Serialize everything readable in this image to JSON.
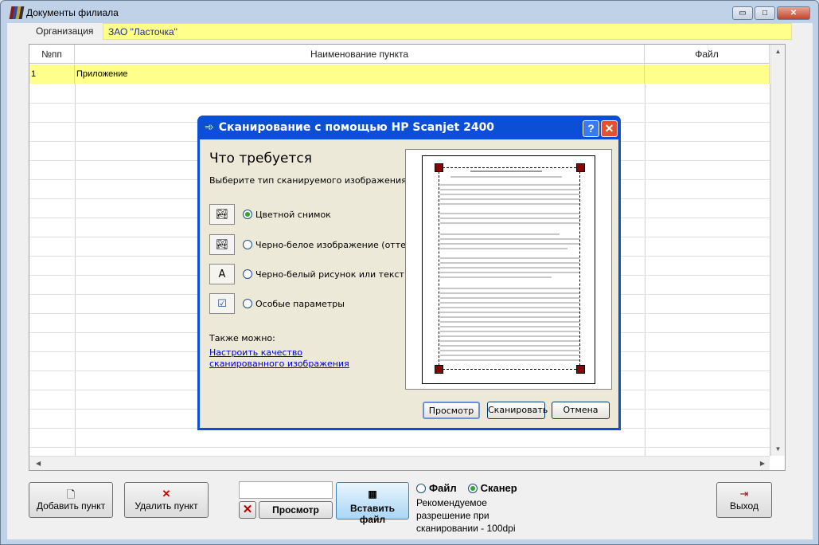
{
  "window": {
    "title": "Документы филиала",
    "min": "▭",
    "max": "□",
    "close": "✕"
  },
  "org": {
    "label": "Организация",
    "value": "ЗАО \"Ласточка\""
  },
  "grid": {
    "columns": [
      "№пп",
      "Наименование пункта",
      "Файл"
    ],
    "rows": [
      {
        "num": "1",
        "name": "Приложение",
        "file": ""
      }
    ]
  },
  "dialog": {
    "title": "Сканирование с помощью HP Scanjet 2400",
    "help": "?",
    "close": "✕",
    "heading": "Что требуется",
    "subtitle": "Выберите тип сканируемого изображения.",
    "options": [
      {
        "label": "Цветной снимок",
        "selected": true
      },
      {
        "label": "Черно-белое изображение (оттенки",
        "selected": false
      },
      {
        "label": "Черно-белый рисунок или текст",
        "selected": false
      },
      {
        "label": "Особые параметры",
        "selected": false
      }
    ],
    "also": "Также можно:",
    "link": "Настроить качество сканированного изображения",
    "buttons": {
      "preview": "Просмотр",
      "scan": "Сканировать",
      "cancel": "Отмена"
    }
  },
  "bottom": {
    "add": "Добавить пункт",
    "delete": "Удалить пункт",
    "file_input": "",
    "preview": "Просмотр",
    "insert": "Вставить файл",
    "source_file": "Файл",
    "source_scanner": "Сканер",
    "source_selected": "Сканер",
    "hint": "Рекомендуемое разрешение при сканировании - 100dpi",
    "exit": "Выход"
  }
}
